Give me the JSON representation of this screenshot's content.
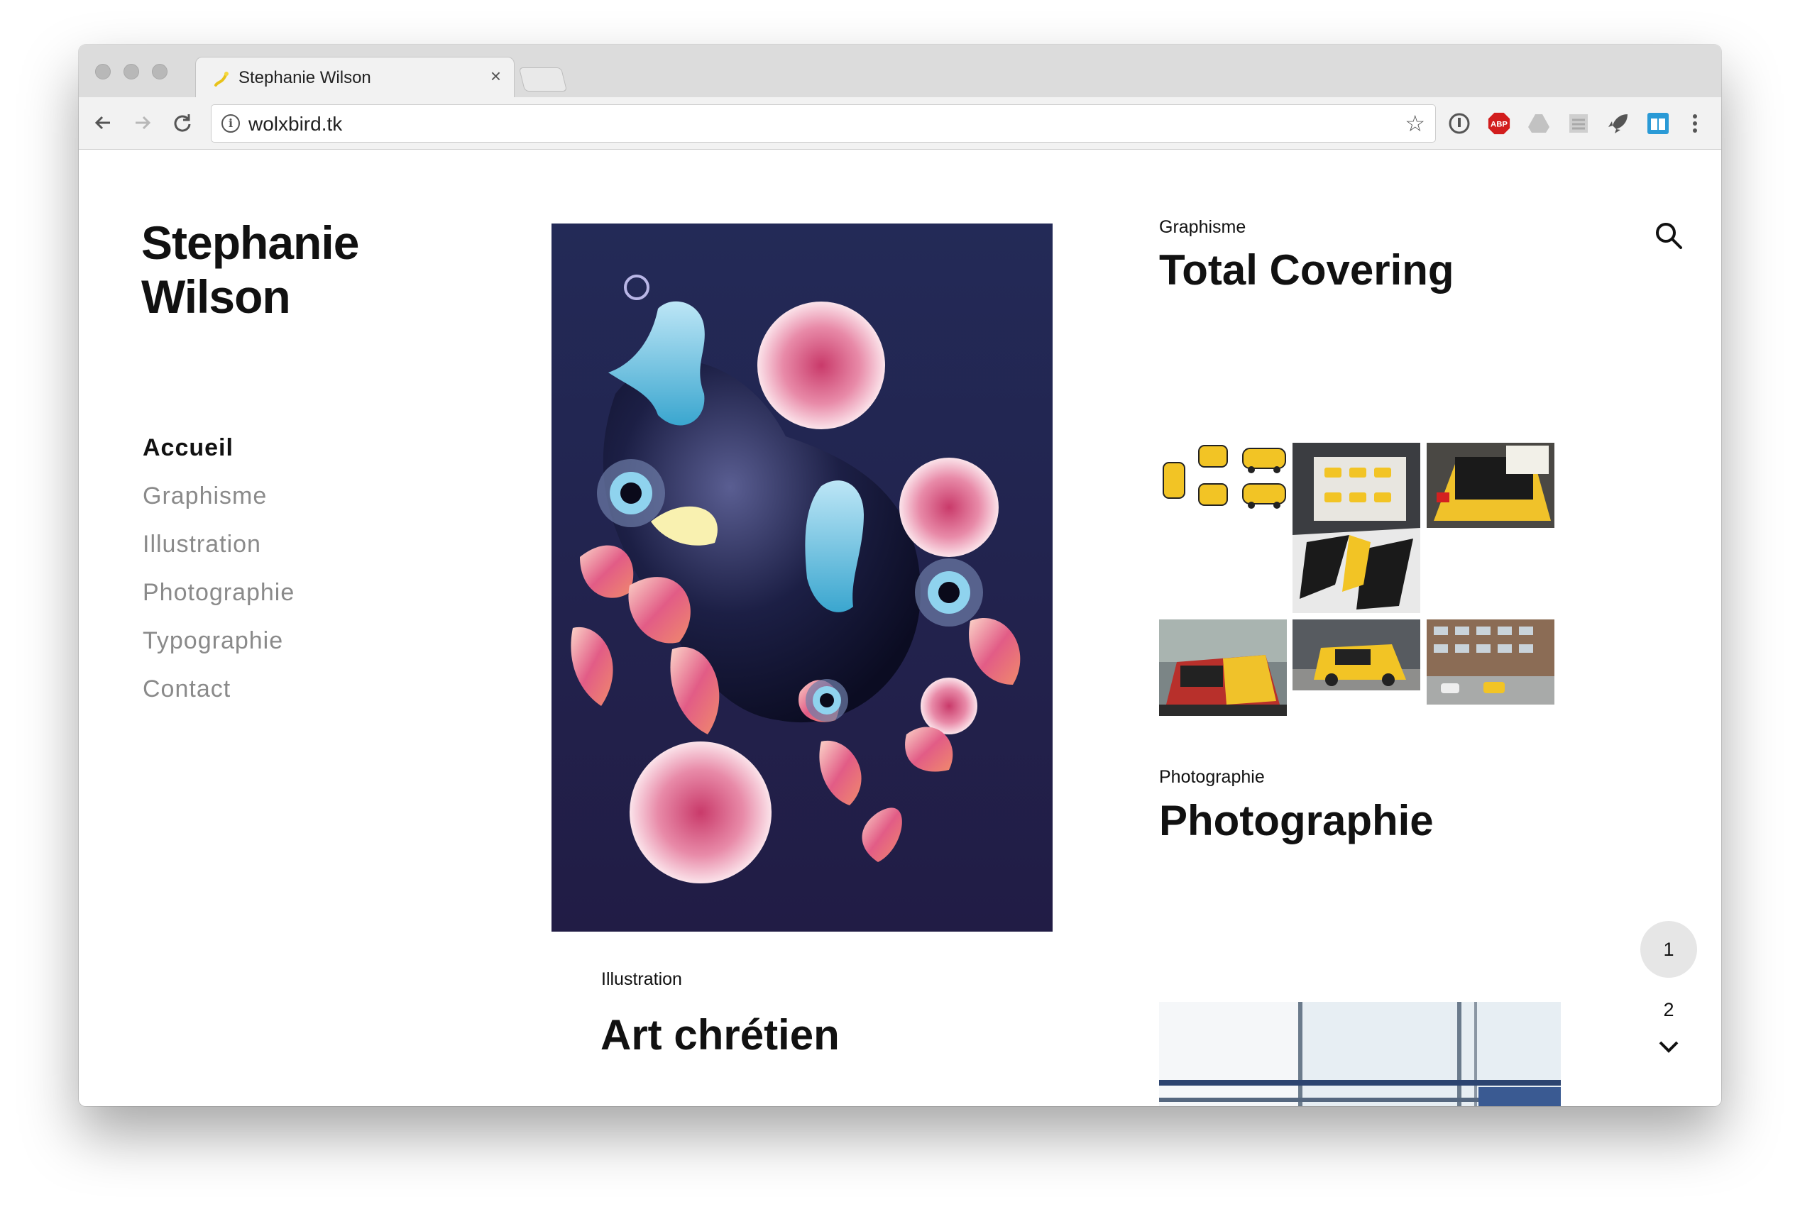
{
  "browser": {
    "tab_title": "Stephanie Wilson",
    "tab_close": "×",
    "url": "wolxbird.tk",
    "url_info_glyph": "i",
    "bookmark_glyph": "☆",
    "icons": [
      "back-arrow-icon",
      "forward-arrow-icon",
      "reload-icon",
      "info-icon",
      "star-icon",
      "password-extension-icon",
      "adblock-plus-icon",
      "drive-icon",
      "stack-extension-icon",
      "rocket-icon",
      "reader-icon",
      "more-icon"
    ],
    "adblock_label": "ABP"
  },
  "site": {
    "title": "Stephanie\nWilson"
  },
  "nav": {
    "items": [
      {
        "label": "Accueil"
      },
      {
        "label": "Graphisme"
      },
      {
        "label": "Illustration"
      },
      {
        "label": "Photographie"
      },
      {
        "label": "Typographie"
      },
      {
        "label": "Contact"
      }
    ]
  },
  "posts": {
    "featured": {
      "category": "Illustration",
      "title": "Art chrétien"
    },
    "graphisme": {
      "category": "Graphisme",
      "title": "Total Covering"
    },
    "photo": {
      "category": "Photographie",
      "title": "Photographie"
    }
  },
  "pagination": {
    "current": "1",
    "next_page": "2"
  },
  "colors": {
    "accent_text": "#111111",
    "muted_nav": "#8a8a8a",
    "illustration_bg": "#22254f",
    "flower_pink": "#e05a86",
    "car_yellow": "#f2c425"
  }
}
